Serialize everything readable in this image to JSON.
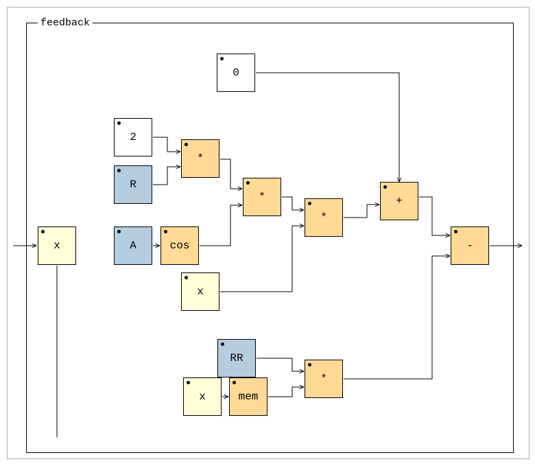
{
  "frame": {
    "label": "feedback"
  },
  "nodes": {
    "zero": {
      "label": "0"
    },
    "two": {
      "label": "2"
    },
    "R": {
      "label": "R"
    },
    "A": {
      "label": "A"
    },
    "x": {
      "label": "x"
    },
    "x2": {
      "label": "x"
    },
    "x3": {
      "label": "x"
    },
    "cos": {
      "label": "cos"
    },
    "mem": {
      "label": "mem"
    },
    "RR": {
      "label": "RR"
    },
    "mul1": {
      "label": "*"
    },
    "mul2": {
      "label": "*"
    },
    "mul3": {
      "label": "*"
    },
    "mul4": {
      "label": "*"
    },
    "plus": {
      "label": "+"
    },
    "minus": {
      "label": "-"
    }
  }
}
